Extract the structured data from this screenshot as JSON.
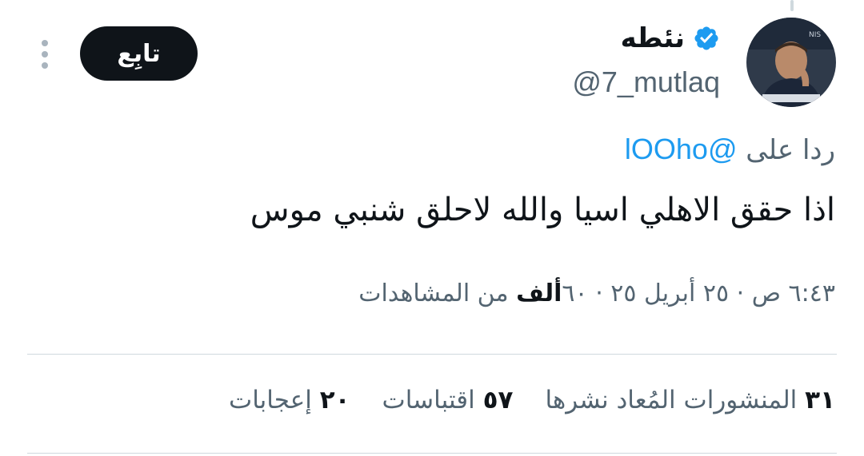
{
  "author": {
    "display_name": "نئطه",
    "handle": "@7_mutlaq",
    "verified": true,
    "avatar_icon": "profile-photo"
  },
  "follow_button_label": "تابِع",
  "more_icon": "vertical-ellipsis-icon",
  "reply": {
    "prefix": "ردا على",
    "mention": "@lOOho"
  },
  "tweet_text": "اذا حقق الاهلي اسيا والله لاحلق شنبي موس",
  "meta": {
    "timestamp": "٦:٤٣ ص · ٢٥ أبريل ٢٥ · ٦٠",
    "views_count": "ألف",
    "views_label": "من المشاهدات"
  },
  "stats": {
    "reposts_count": "٣١",
    "reposts_label": "المنشورات المُعاد نشرها",
    "quotes_count": "٥٧",
    "quotes_label": "اقتباسات",
    "likes_count": "٢٠",
    "likes_label": "إعجابات"
  },
  "colors": {
    "accent": "#1d9bf0",
    "text": "#0f1419",
    "secondary": "#536471",
    "divider": "#cfd9de"
  }
}
